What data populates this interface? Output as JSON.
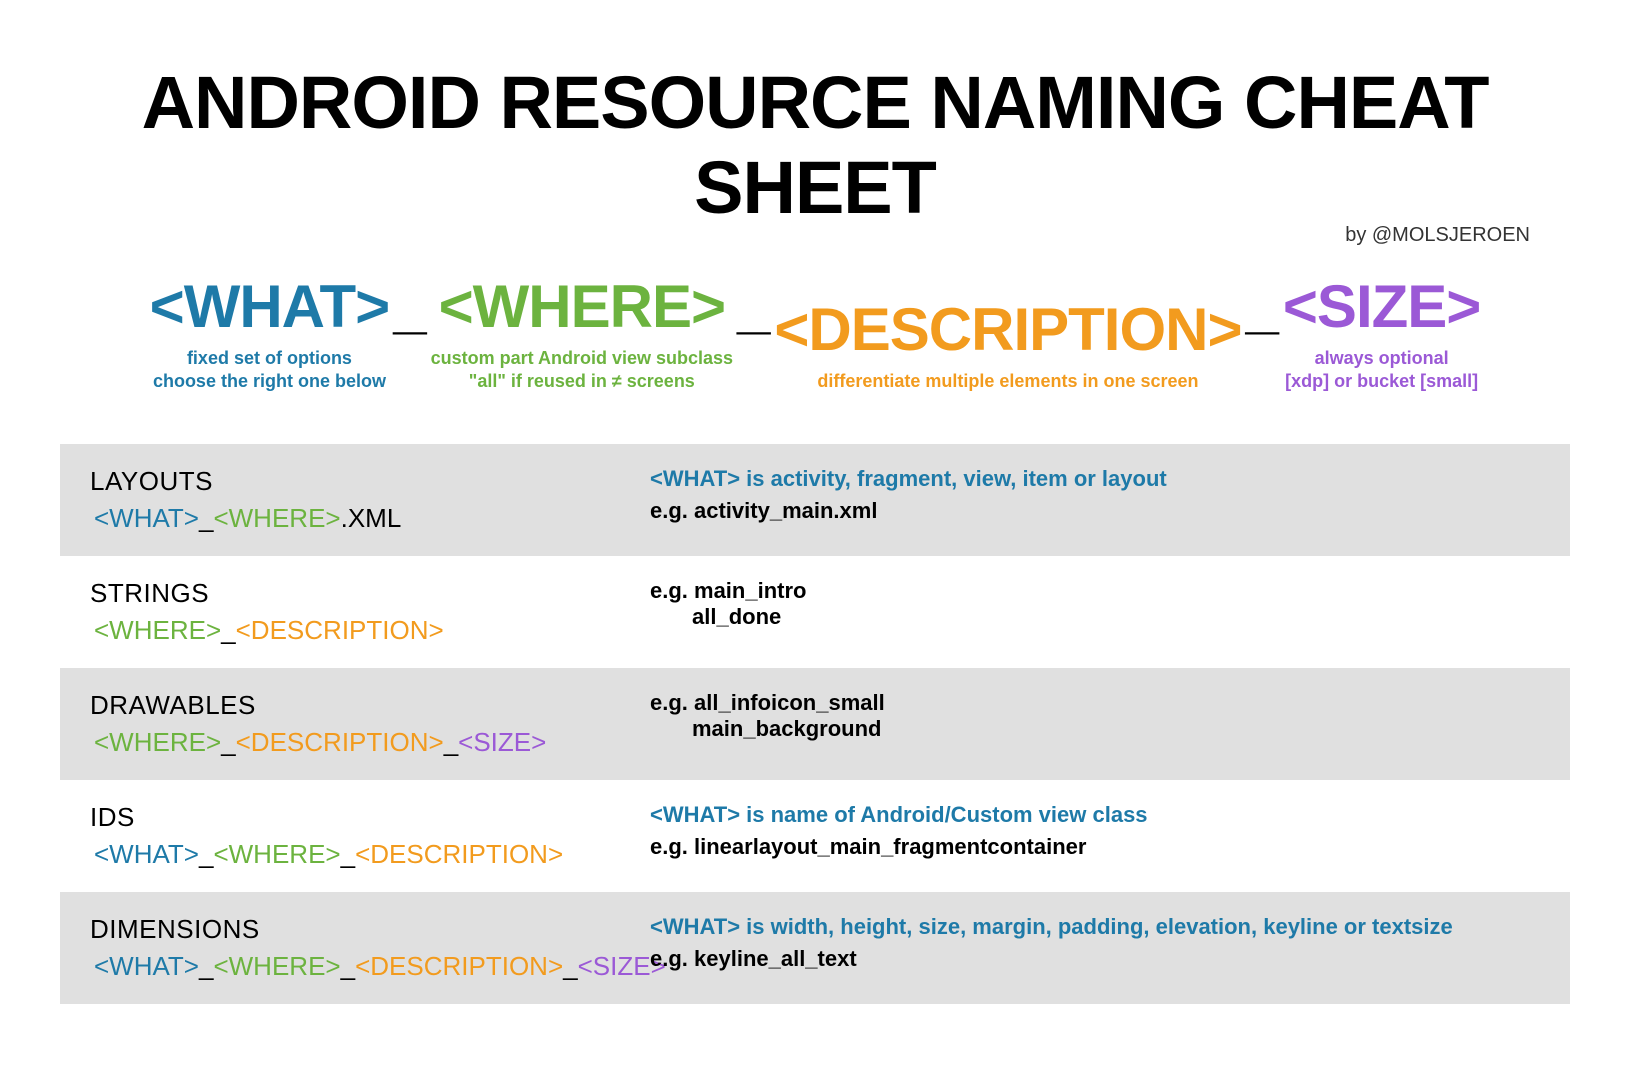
{
  "title": "ANDROID RESOURCE NAMING CHEAT SHEET",
  "byline": "by @MOLSJEROEN",
  "formula": {
    "what": {
      "tag": "<WHAT>",
      "sub": "fixed set of options\nchoose the right one below"
    },
    "where": {
      "tag": "<WHERE>",
      "sub": "custom part Android view subclass\n\"all\" if reused in ≠ screens"
    },
    "desc": {
      "tag": "<DESCRIPTION>",
      "sub": "differentiate multiple elements in one screen"
    },
    "size": {
      "tag": "<SIZE>",
      "sub": "always optional\n[xdp] or bucket [small]"
    }
  },
  "rows": {
    "layouts": {
      "heading": "LAYOUTS",
      "pattern_what": "<WHAT>",
      "pattern_where": "<WHERE>",
      "pattern_suffix": ".XML",
      "note": "<WHAT> is activity, fragment, view, item or layout",
      "example": "e.g. activity_main.xml"
    },
    "strings": {
      "heading": "STRINGS",
      "pattern_where": "<WHERE>",
      "pattern_desc": "<DESCRIPTION>",
      "example_l1": "e.g. main_intro",
      "example_l2": "all_done"
    },
    "drawables": {
      "heading": "DRAWABLES",
      "pattern_where": "<WHERE>",
      "pattern_desc": "<DESCRIPTION>",
      "pattern_size": "<SIZE>",
      "example_l1": "e.g. all_infoicon_small",
      "example_l2": "main_background"
    },
    "ids": {
      "heading": "IDS",
      "pattern_what": "<WHAT>",
      "pattern_where": "<WHERE>",
      "pattern_desc": "<DESCRIPTION>",
      "note": "<WHAT> is name of Android/Custom view class",
      "example": "e.g. linearlayout_main_fragmentcontainer"
    },
    "dimensions": {
      "heading": "DIMENSIONS",
      "pattern_what": "<WHAT>",
      "pattern_where": "<WHERE>",
      "pattern_desc": "<DESCRIPTION>",
      "pattern_size": "<SIZE>",
      "note": "<WHAT> is width, height, size, margin, padding, elevation, keyline or textsize",
      "example": "e.g. keyline_all_text"
    }
  },
  "sep": "_"
}
